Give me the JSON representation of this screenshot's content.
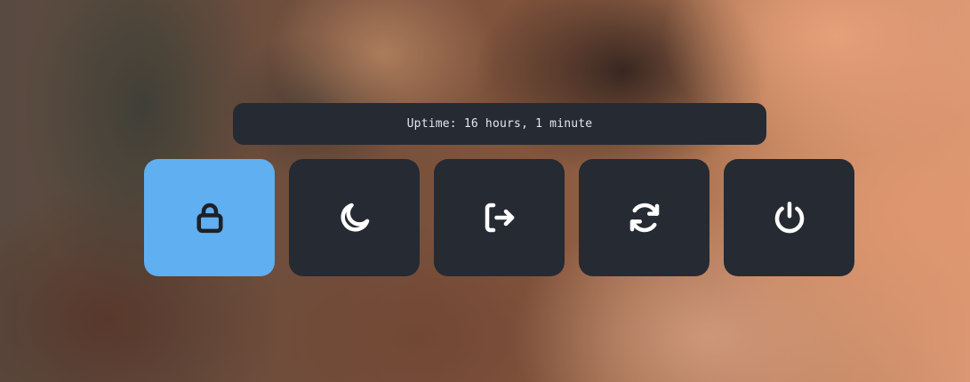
{
  "status": {
    "uptime": "Uptime: 16 hours, 1 minute"
  },
  "actions": [
    {
      "id": "lock",
      "icon": "lock-icon",
      "selected": true
    },
    {
      "id": "suspend",
      "icon": "moon-icon",
      "selected": false
    },
    {
      "id": "logout",
      "icon": "logout-icon",
      "selected": false
    },
    {
      "id": "reboot",
      "icon": "refresh-icon",
      "selected": false
    },
    {
      "id": "shutdown",
      "icon": "power-icon",
      "selected": false
    }
  ],
  "colors": {
    "panel": "#262a33",
    "selected": "#60aff0",
    "icon_light": "#ffffff",
    "icon_dark": "#1d2029",
    "text": "#e6e8ee"
  }
}
